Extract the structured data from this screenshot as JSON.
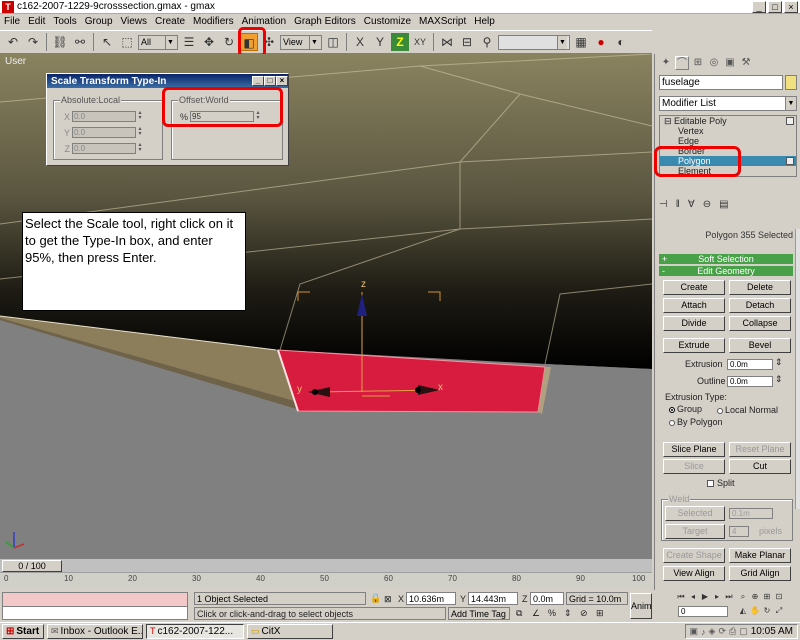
{
  "window": {
    "title": "c162-2007-1229-9crosssection.gmax - gmax",
    "app_icon": "T"
  },
  "menu": [
    "File",
    "Edit",
    "Tools",
    "Group",
    "Views",
    "Create",
    "Modifiers",
    "Animation",
    "Graph Editors",
    "Customize",
    "MAXScript",
    "Help"
  ],
  "toolbar": {
    "selection_filter": "All",
    "ref_coord": "View",
    "axis_xy": "XY",
    "axis_z": "Z"
  },
  "viewport": {
    "label": "User",
    "axis_x": "x",
    "axis_y": "y",
    "axis_z": "z"
  },
  "typein": {
    "title": "Scale Transform Type-In",
    "left_group": "Absolute:Local",
    "right_group": "Offset:World",
    "x_label": "X",
    "y_label": "Y",
    "z_label": "Z",
    "x_value": "0.0",
    "y_value": "0.0",
    "z_value": "0.0",
    "pct_label": "%",
    "pct_value": "95"
  },
  "instruction": "Select the Scale tool, right click on it to get the Type-In box, and enter 95%, then press Enter.",
  "command_panel": {
    "object_name": "fuselage",
    "modifier_list": "Modifier List",
    "stack": [
      {
        "label": "Editable Poly",
        "sub": false
      },
      {
        "label": "Vertex",
        "sub": true
      },
      {
        "label": "Edge",
        "sub": true
      },
      {
        "label": "Border",
        "sub": true
      },
      {
        "label": "Polygon",
        "sub": true,
        "selected": true
      },
      {
        "label": "Element",
        "sub": true
      }
    ],
    "poly_selected": "Polygon 355 Selected",
    "soft_selection": "Soft Selection",
    "soft_sign": "+",
    "edit_geometry": "Edit Geometry",
    "edit_sign": "-",
    "create": "Create",
    "delete": "Delete",
    "attach": "Attach",
    "detach": "Detach",
    "divide": "Divide",
    "collapse": "Collapse",
    "extrude": "Extrude",
    "bevel": "Bevel",
    "extrusion_label": "Extrusion",
    "extrusion_value": "0.0m",
    "outline_label": "Outline",
    "outline_value": "0.0m",
    "extrusion_type": "Extrusion Type:",
    "group": "Group",
    "local_normal": "Local Normal",
    "by_polygon": "By Polygon",
    "slice_plane": "Slice Plane",
    "reset_plane": "Reset Plane",
    "slice": "Slice",
    "cut": "Cut",
    "split": "Split",
    "weld": "Weld",
    "selected": "Selected",
    "selected_value": "0.1m",
    "target": "Target",
    "target_value": "4",
    "pixels": "pixels",
    "create_shape": "Create Shape",
    "make_planar": "Make Planar",
    "view_align": "View Align",
    "grid_align": "Grid Align"
  },
  "timeline": {
    "slider": "0 / 100",
    "ticks": [
      "0",
      "10",
      "20",
      "30",
      "40",
      "50",
      "60",
      "70",
      "80",
      "90",
      "100"
    ]
  },
  "status": {
    "objects": "1 Object Selected",
    "prompt": "Click or click-and-drag to select objects",
    "x_label": "X",
    "x_value": "10.636m",
    "y_label": "Y",
    "y_value": "14.443m",
    "z_label": "Z",
    "z_value": "0.0m",
    "grid": "Grid = 10.0m",
    "add_time_tag": "Add Time Tag",
    "anim": "Anim",
    "frame": "0"
  },
  "taskbar": {
    "start": "Start",
    "items": [
      "Inbox - Outlook E...",
      "c162-2007-122...",
      "CitX"
    ],
    "clock": "10:05 AM"
  },
  "colors": {
    "polygon_selection": "#d81c40",
    "highlight_ring": "#e00000",
    "rollout_header": "#48a048",
    "stack_selection": "#3a8ab0"
  }
}
